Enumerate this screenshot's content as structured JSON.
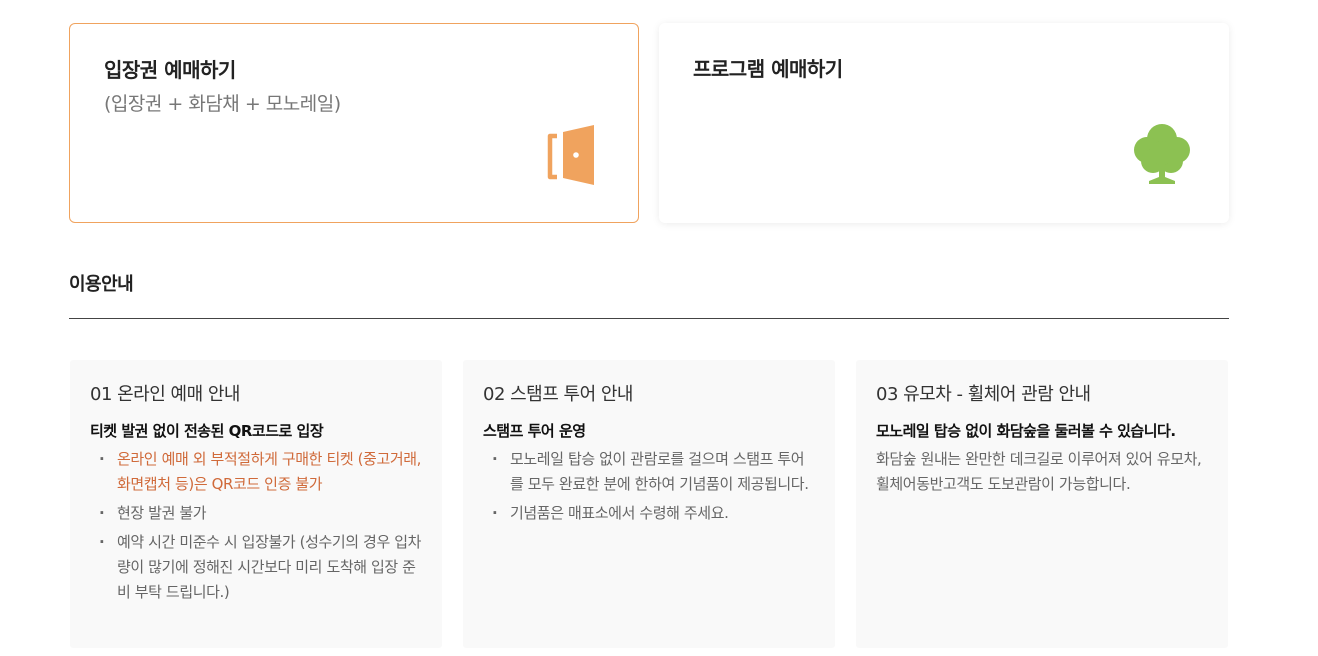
{
  "cards": {
    "ticket": {
      "title": "입장권 예매하기",
      "subtitle": "(입장권 + 화담채 + 모노레일)",
      "icon": "door-icon",
      "accent": "#f0a35e"
    },
    "program": {
      "title": "프로그램 예매하기",
      "icon": "tree-icon",
      "accent": "#8cc152"
    }
  },
  "section": {
    "title": "이용안내"
  },
  "info": [
    {
      "title": "01 온라인 예매 안내",
      "heading": "티켓 발권 없이 전송된 QR코드로 입장",
      "items": [
        "온라인 예매 외 부적절하게 구매한 티켓 (중고거래, 화면캡처 등)은 QR코드 인증 불가",
        "현장 발권 불가",
        "예약 시간 미준수 시 입장불가 (성수기의 경우 입차량이 많기에 정해진 시간보다 미리 도착해 입장 준비 부탁 드립니다.)"
      ]
    },
    {
      "title": "02 스탬프 투어 안내",
      "heading": "스탬프 투어 운영",
      "items": [
        "모노레일 탑승 없이 관람로를 걸으며 스탬프 투어를 모두 완료한 분에 한하여 기념품이 제공됩니다.",
        "기념품은 매표소에서 수령해 주세요."
      ]
    },
    {
      "title": "03 유모차 - 휠체어 관람 안내",
      "heading": "모노레일 탑승 없이 화담숲을 둘러볼 수 있습니다.",
      "text": "화담숲 원내는 완만한 데크길로 이루어져 있어 유모차, 휠체어동반고객도 도보관람이 가능합니다."
    }
  ]
}
